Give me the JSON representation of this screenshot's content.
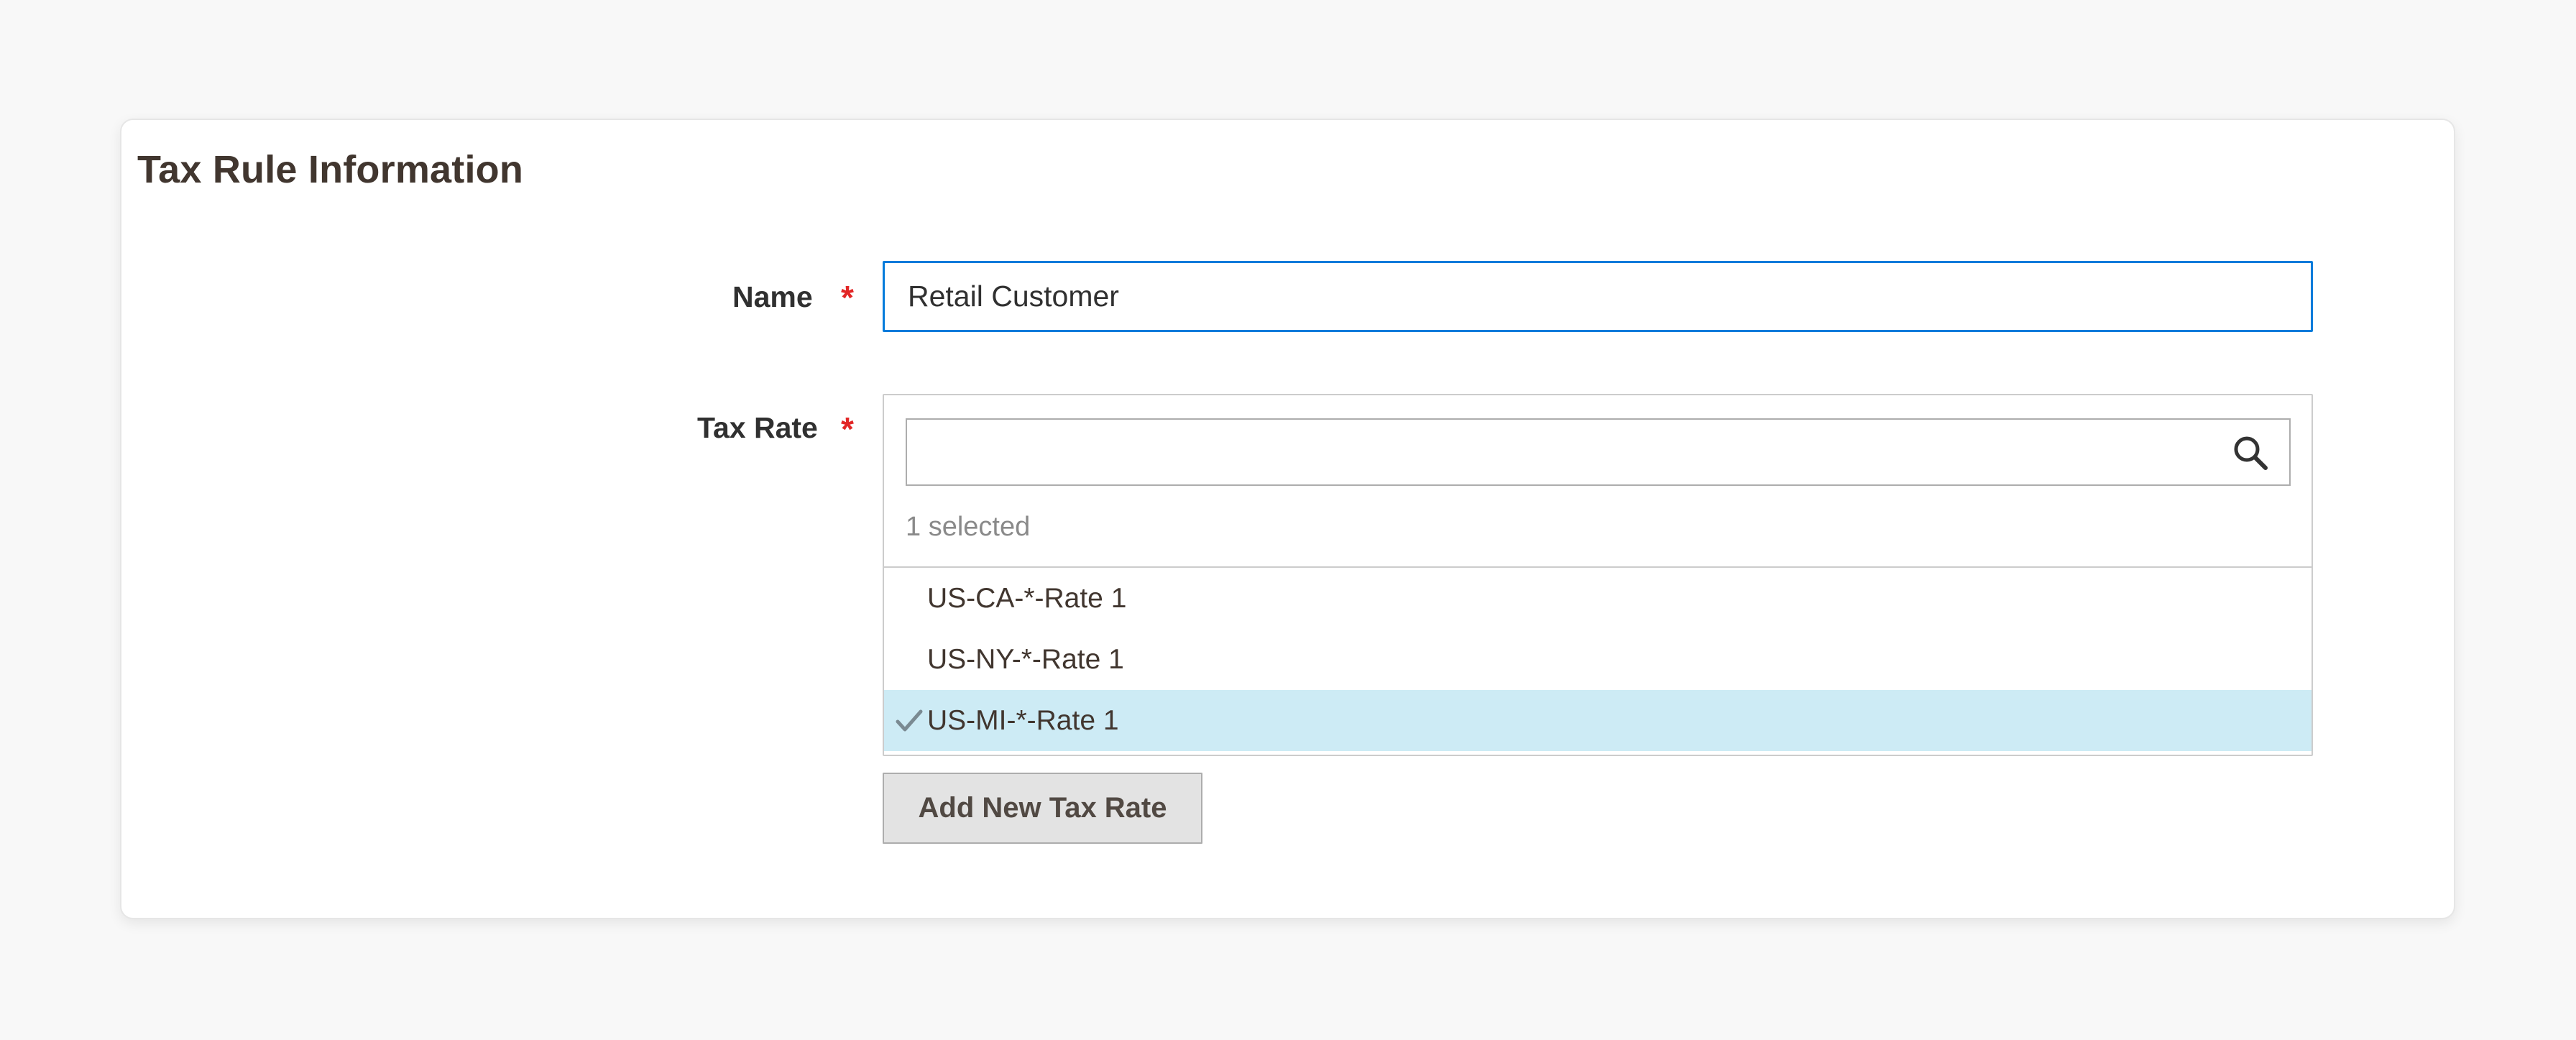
{
  "section": {
    "title": "Tax Rule Information"
  },
  "name_field": {
    "label": "Name",
    "required_marker": "*",
    "value": "Retail Customer"
  },
  "tax_rate_field": {
    "label": "Tax Rate",
    "required_marker": "*",
    "search_placeholder": "",
    "selected_count": "1 selected",
    "options": [
      {
        "label": "US-CA-*-Rate 1",
        "selected": false
      },
      {
        "label": "US-NY-*-Rate 1",
        "selected": false
      },
      {
        "label": "US-MI-*-Rate 1",
        "selected": true
      }
    ]
  },
  "add_button": {
    "label": "Add New Tax Rate"
  },
  "colors": {
    "accent_border": "#007bdb",
    "required": "#e22626",
    "selected_row": "#cdebf5"
  },
  "icons": {
    "search": "search-icon",
    "check": "check-icon"
  }
}
